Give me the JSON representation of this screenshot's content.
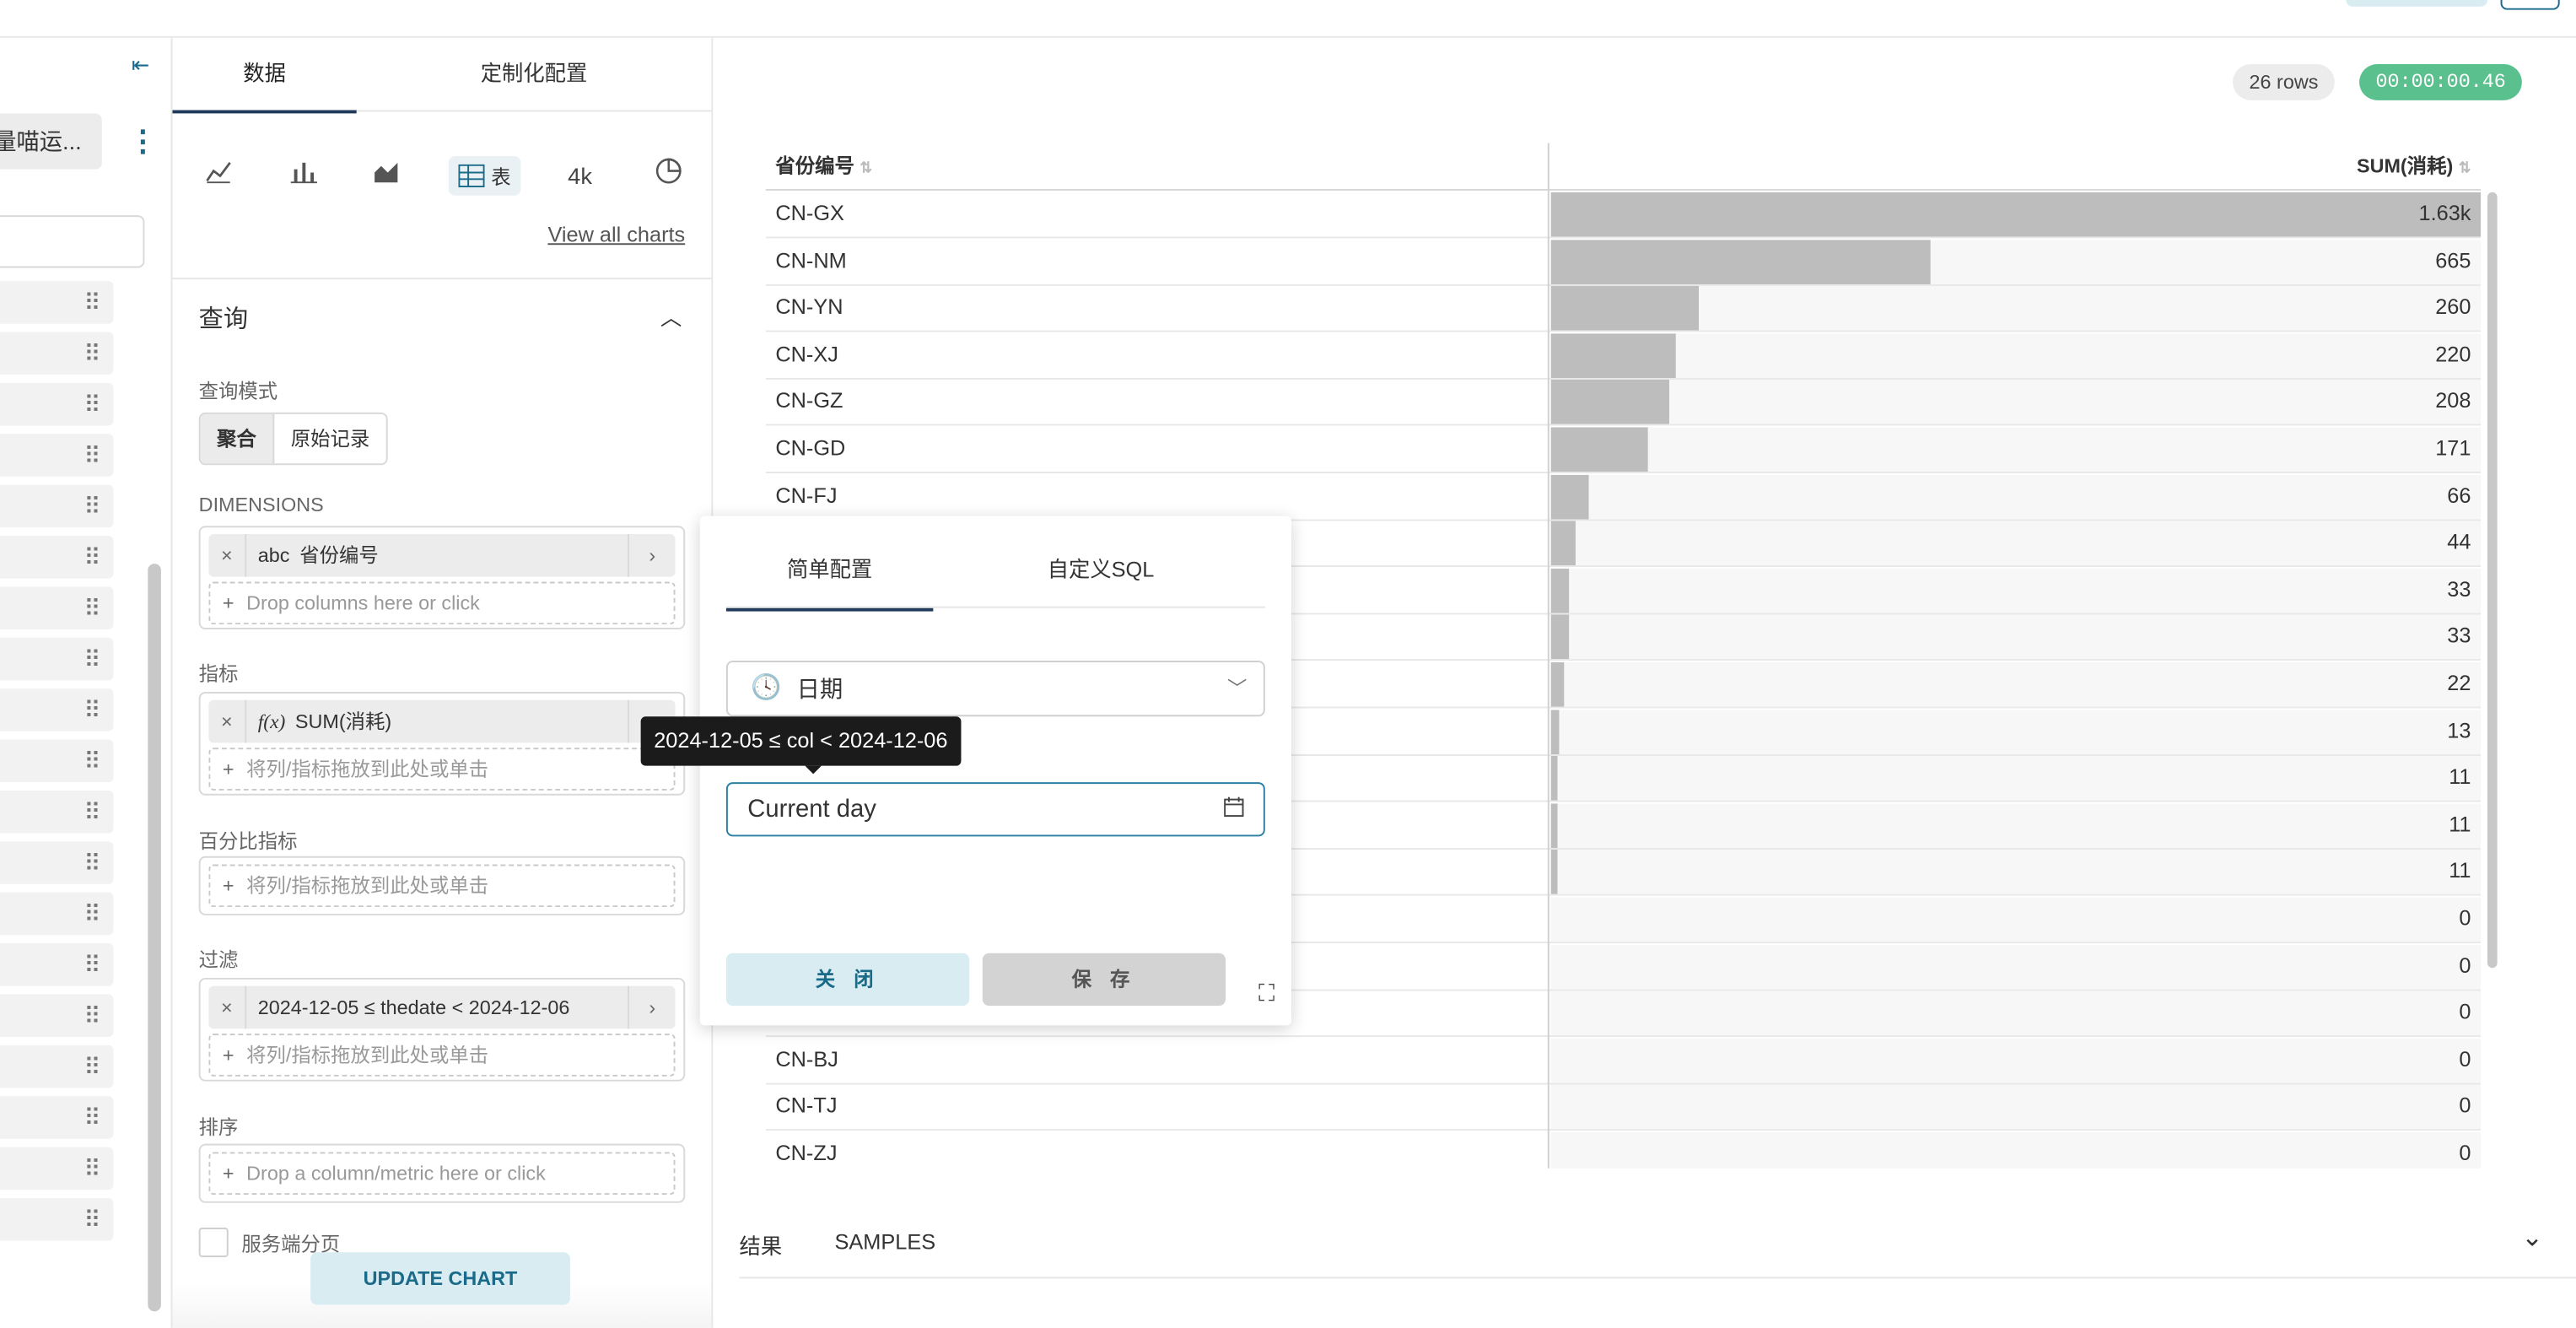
{
  "datasource": {
    "name": "量喵运...",
    "collapse_icon": "collapse-left-icon",
    "more_icon": "kebab-icon",
    "row_count": 19
  },
  "control_panel": {
    "tabs": [
      "数据",
      "定制化配置"
    ],
    "viz_types": [
      {
        "icon": "line-chart-icon",
        "label": ""
      },
      {
        "icon": "bar-chart-icon",
        "label": ""
      },
      {
        "icon": "area-chart-icon",
        "label": ""
      },
      {
        "icon": "table-icon",
        "label": "表"
      },
      {
        "icon": "big-number-icon",
        "label": "4k"
      },
      {
        "icon": "pie-chart-icon",
        "label": ""
      }
    ],
    "view_all": "View all charts",
    "query_title": "查询",
    "query_mode_label": "查询模式",
    "query_modes": [
      "聚合",
      "原始记录"
    ],
    "dimensions_label": "DIMENSIONS",
    "dimension_pill": {
      "type": "abc",
      "text": "省份编号"
    },
    "dimensions_placeholder": "Drop columns here or click",
    "metrics_label": "指标",
    "metric_pill": {
      "type": "f(x)",
      "text": "SUM(消耗)"
    },
    "metrics_placeholder": "将列/指标拖放到此处或单击",
    "percent_label": "百分比指标",
    "percent_placeholder": "将列/指标拖放到此处或单击",
    "filter_label": "过滤",
    "filter_pill": {
      "text": "2024-12-05 ≤ thedate < 2024-12-06"
    },
    "filter_placeholder": "将列/指标拖放到此处或单击",
    "sort_label": "排序",
    "sort_placeholder": "Drop a column/metric here or click",
    "server_pagination": "服务端分页",
    "update_button": "UPDATE CHART"
  },
  "results": {
    "rows_badge": "26 rows",
    "time_badge": "00:00:00.46",
    "columns": [
      "省份编号",
      "SUM(消耗)"
    ],
    "max_value": 1630,
    "rows": [
      {
        "code": "CN-GX",
        "label": "1.63k",
        "value": 1630
      },
      {
        "code": "CN-NM",
        "label": "665",
        "value": 665
      },
      {
        "code": "CN-YN",
        "label": "260",
        "value": 260
      },
      {
        "code": "CN-XJ",
        "label": "220",
        "value": 220
      },
      {
        "code": "CN-GZ",
        "label": "208",
        "value": 208
      },
      {
        "code": "CN-GD",
        "label": "171",
        "value": 171
      },
      {
        "code": "CN-FJ",
        "label": "66",
        "value": 66
      },
      {
        "code": "",
        "label": "44",
        "value": 44
      },
      {
        "code": "",
        "label": "33",
        "value": 33
      },
      {
        "code": "",
        "label": "33",
        "value": 33
      },
      {
        "code": "",
        "label": "22",
        "value": 22
      },
      {
        "code": "",
        "label": "13",
        "value": 13
      },
      {
        "code": "",
        "label": "11",
        "value": 11
      },
      {
        "code": "",
        "label": "11",
        "value": 11
      },
      {
        "code": "",
        "label": "11",
        "value": 11
      },
      {
        "code": "",
        "label": "0",
        "value": 0
      },
      {
        "code": "",
        "label": "0",
        "value": 0
      },
      {
        "code": "",
        "label": "0",
        "value": 0
      },
      {
        "code": "CN-BJ",
        "label": "0",
        "value": 0
      },
      {
        "code": "CN-TJ",
        "label": "0",
        "value": 0
      },
      {
        "code": "CN-ZJ",
        "label": "0",
        "value": 0
      }
    ],
    "bottom_tabs": [
      "结果",
      "SAMPLES"
    ]
  },
  "popover": {
    "tabs": [
      "简单配置",
      "自定义SQL"
    ],
    "column_select": "日期",
    "time_range_value": "Current day",
    "close_button": "关 闭",
    "save_button": "保 存"
  },
  "tooltip": "2024-12-05 ≤ col < 2024-12-06"
}
